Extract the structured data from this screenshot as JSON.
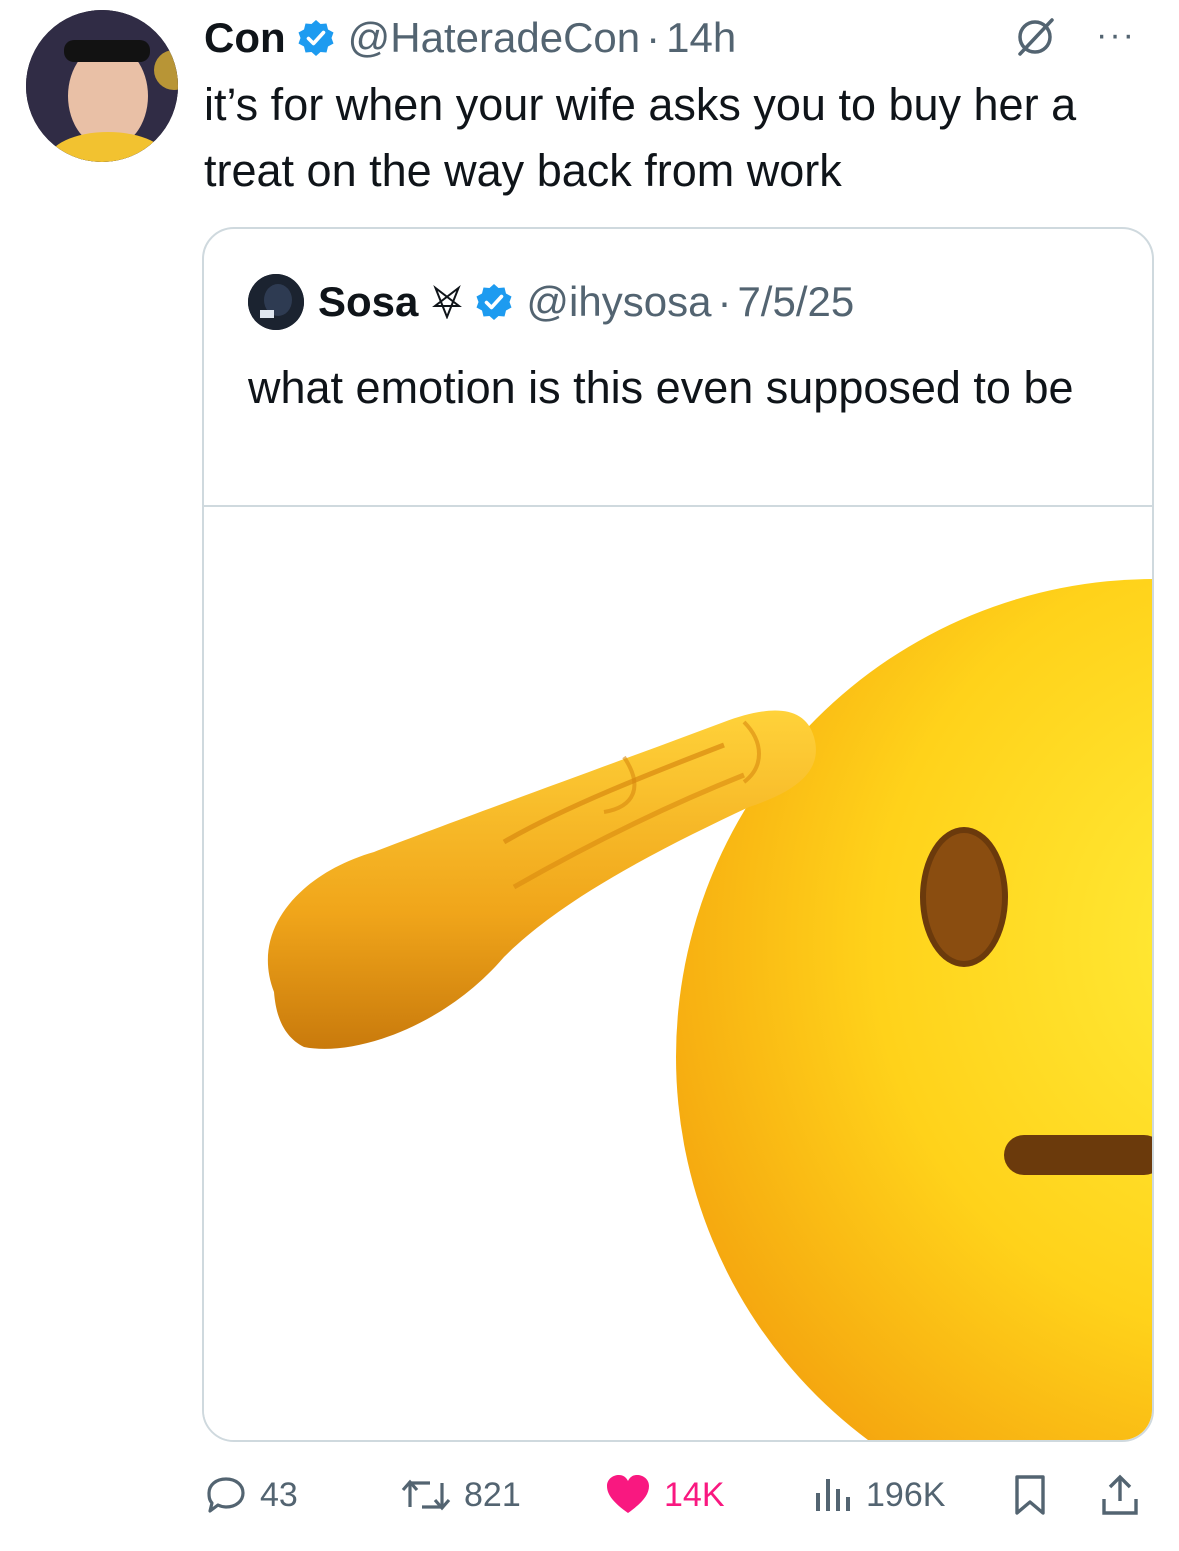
{
  "tweet": {
    "author_name": "Con",
    "handle": "@HateradeCon",
    "separator": "·",
    "time": "14h",
    "more_label": "···",
    "text": "it’s for when your wife asks you to buy her a treat on the way back from work"
  },
  "quote": {
    "author_name": "Sosa",
    "handle": "@ihysosa",
    "separator": "·",
    "date": "7/5/25",
    "text": "what emotion is this even supposed to be",
    "media": "saluting-face emoji"
  },
  "actions": {
    "replies": "43",
    "reposts": "821",
    "likes": "14K",
    "views": "196K"
  },
  "colors": {
    "verified": "#1d9bf0",
    "like": "#f91880",
    "muted": "#536471",
    "border": "#cfd9de"
  }
}
